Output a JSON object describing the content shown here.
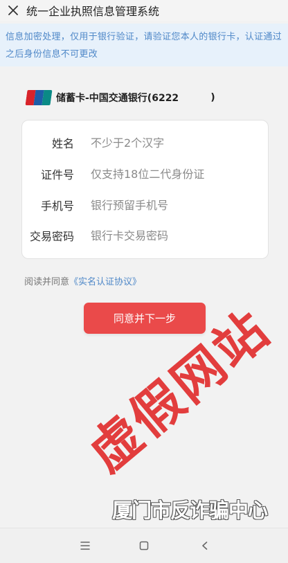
{
  "header": {
    "title": "统一企业执照信息管理系统",
    "close_icon": "close-icon"
  },
  "notice": {
    "text": "信息加密处理，仅用于银行验证，请验证您本人的银行卡，认证通过之后身份信息不可更改"
  },
  "card": {
    "logo_icon": "unionpay-logo",
    "label": "储蓄卡-中国交通银行(6222",
    "label_end": ")"
  },
  "form": {
    "fields": [
      {
        "label": "姓名",
        "placeholder": "不少于2个汉字"
      },
      {
        "label": "证件号",
        "placeholder": "仅支持18位二代身份证"
      },
      {
        "label": "手机号",
        "placeholder": "银行预留手机号"
      },
      {
        "label": "交易密码",
        "placeholder": "银行卡交易密码"
      }
    ]
  },
  "agreement": {
    "prefix": "阅读并同意",
    "link": "《实名认证协议》"
  },
  "next_button": {
    "label": "同意并下一步"
  },
  "overlay": {
    "watermark": "虚假网站",
    "source": "厦门市反诈骗中心"
  },
  "navbar": {
    "menu_icon": "menu-icon",
    "home_icon": "home-icon",
    "back_icon": "back-icon"
  },
  "colors": {
    "primary": "#ea4a4a",
    "notice_bg": "#e7f1fb",
    "notice_text": "#4f88c8",
    "watermark": "#e12e2e"
  }
}
